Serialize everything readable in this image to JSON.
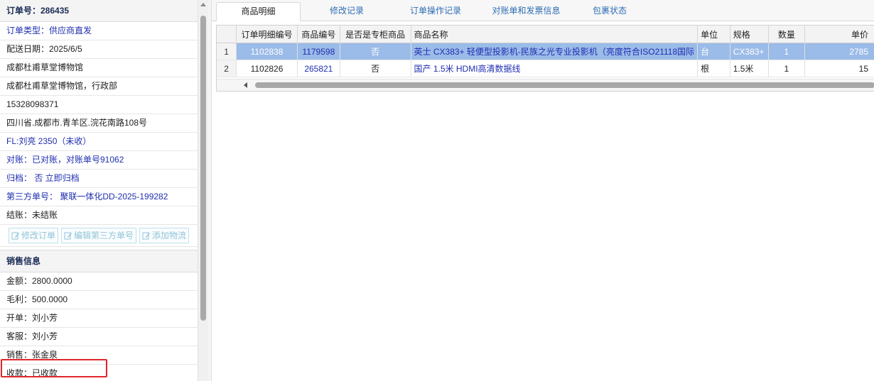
{
  "order": {
    "number_label": "订单号：286435",
    "type": "订单类型：供应商直发",
    "delivery_date": "配送日期：2025/6/5",
    "customer": "成都杜甫草堂博物馆",
    "department": "成都杜甫草堂博物馆，行政部",
    "phone": "15328098371",
    "address": "四川省.成都市.青羊区.浣花南路108号",
    "fl": "FL:刘亮 2350（未收）",
    "reconcile": "对账：已对账，对账单号91062",
    "archive": "归档： 否 立即归档",
    "third_party": "第三方单号： 聚联一体化DD-2025-199282",
    "settle": "结账：未结账"
  },
  "left_buttons": {
    "edit_order": "修改订单",
    "edit_third_party": "编辑第三方单号",
    "add_logistics": "添加物流"
  },
  "sales": {
    "title": "销售信息",
    "amount": "金额：2800.0000",
    "profit": "毛利：500.0000",
    "issuer": "开单：刘小芳",
    "service": "客服：刘小芳",
    "seller": "销售：张金泉",
    "payment": "收款：已收款"
  },
  "tabs": [
    "商品明细",
    "修改记录",
    "订单操作记录",
    "对账单和发票信息",
    "包裹状态"
  ],
  "table": {
    "headers": [
      "",
      "订单明细编号",
      "商品编号",
      "是否是专柜商品",
      "商品名称",
      "单位",
      "规格",
      "数量",
      "单价"
    ],
    "rows": [
      [
        "1",
        "1102838",
        "1179598",
        "否",
        "英士 CX383+ 轻便型投影机-民族之光专业投影机（亮度符合ISO21118国际",
        "台",
        "CX383+",
        "1",
        "2785"
      ],
      [
        "2",
        "1102826",
        "265821",
        "否",
        "国产 1.5米 HDMI高清数据线",
        "根",
        "1.5米",
        "1",
        "15"
      ]
    ]
  },
  "colors": {
    "highlight_border": "#e0262b",
    "selected_row": "#9bbbe8",
    "link_blue": "#1f2fb0",
    "tab_blue": "#2e6db5"
  }
}
